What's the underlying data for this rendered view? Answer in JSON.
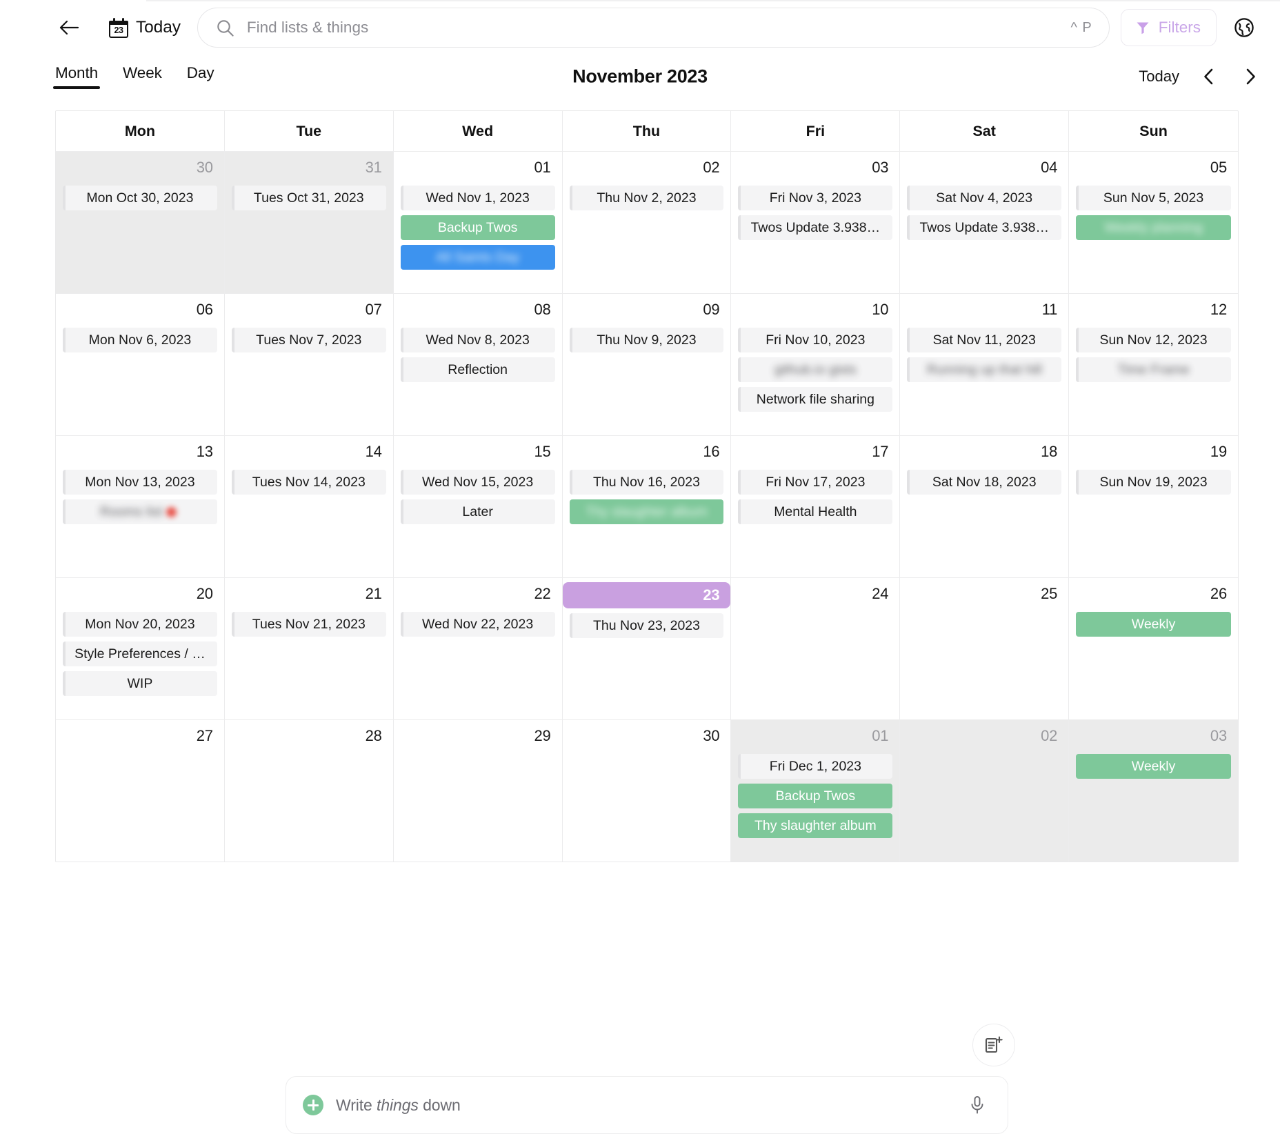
{
  "topbar": {
    "back_icon": "arrow-left-icon",
    "today_jump_label": "Today",
    "calendar_icon_day": "23",
    "search": {
      "placeholder": "Find lists & things",
      "value": "",
      "shortcut": "^ P",
      "icon": "search-icon"
    },
    "filters_label": "Filters",
    "filters_icon": "funnel-icon",
    "globe_icon": "globe-icon"
  },
  "viewbar": {
    "tabs": [
      {
        "label": "Month",
        "active": true
      },
      {
        "label": "Week",
        "active": false
      },
      {
        "label": "Day",
        "active": false
      }
    ],
    "month_title": "November 2023",
    "today_label": "Today",
    "prev_icon": "chevron-left-icon",
    "next_icon": "chevron-right-icon"
  },
  "calendar": {
    "day_headers": [
      "Mon",
      "Tue",
      "Wed",
      "Thu",
      "Fri",
      "Sat",
      "Sun"
    ],
    "weeks": [
      [
        {
          "num": "30",
          "other_month": true,
          "today": false,
          "chips": [
            {
              "text": "Mon Oct 30, 2023",
              "style": "grey"
            }
          ]
        },
        {
          "num": "31",
          "other_month": true,
          "today": false,
          "chips": [
            {
              "text": "Tues Oct 31, 2023",
              "style": "grey"
            }
          ]
        },
        {
          "num": "01",
          "other_month": false,
          "today": false,
          "chips": [
            {
              "text": "Wed Nov 1, 2023",
              "style": "grey"
            },
            {
              "text": "Backup Twos",
              "style": "green"
            },
            {
              "text": "All Saints Day",
              "style": "blue",
              "blurred": true
            }
          ]
        },
        {
          "num": "02",
          "other_month": false,
          "today": false,
          "chips": [
            {
              "text": "Thu Nov 2, 2023",
              "style": "grey"
            }
          ]
        },
        {
          "num": "03",
          "other_month": false,
          "today": false,
          "chips": [
            {
              "text": "Fri Nov 3, 2023",
              "style": "grey"
            },
            {
              "text": "Twos Update 3.938…",
              "style": "grey"
            }
          ]
        },
        {
          "num": "04",
          "other_month": false,
          "today": false,
          "chips": [
            {
              "text": "Sat Nov 4, 2023",
              "style": "grey"
            },
            {
              "text": "Twos Update 3.938…",
              "style": "grey"
            }
          ]
        },
        {
          "num": "05",
          "other_month": false,
          "today": false,
          "chips": [
            {
              "text": "Sun Nov 5, 2023",
              "style": "grey"
            },
            {
              "text": "Weekly planning",
              "style": "green",
              "blurred": true
            }
          ]
        }
      ],
      [
        {
          "num": "06",
          "other_month": false,
          "today": false,
          "chips": [
            {
              "text": "Mon Nov 6, 2023",
              "style": "grey"
            }
          ]
        },
        {
          "num": "07",
          "other_month": false,
          "today": false,
          "chips": [
            {
              "text": "Tues Nov 7, 2023",
              "style": "grey"
            }
          ]
        },
        {
          "num": "08",
          "other_month": false,
          "today": false,
          "chips": [
            {
              "text": "Wed Nov 8, 2023",
              "style": "grey"
            },
            {
              "text": "Reflection",
              "style": "grey"
            }
          ]
        },
        {
          "num": "09",
          "other_month": false,
          "today": false,
          "chips": [
            {
              "text": "Thu Nov 9, 2023",
              "style": "grey"
            }
          ]
        },
        {
          "num": "10",
          "other_month": false,
          "today": false,
          "chips": [
            {
              "text": "Fri Nov 10, 2023",
              "style": "grey"
            },
            {
              "text": "github.io gists",
              "style": "grey",
              "blurred": true
            },
            {
              "text": "Network file sharing",
              "style": "grey"
            }
          ]
        },
        {
          "num": "11",
          "other_month": false,
          "today": false,
          "chips": [
            {
              "text": "Sat Nov 11, 2023",
              "style": "grey"
            },
            {
              "text": "Running up that hill",
              "style": "grey",
              "blurred": true
            }
          ]
        },
        {
          "num": "12",
          "other_month": false,
          "today": false,
          "chips": [
            {
              "text": "Sun Nov 12, 2023",
              "style": "grey"
            },
            {
              "text": "Time Frame",
              "style": "grey",
              "blurred": true
            }
          ]
        }
      ],
      [
        {
          "num": "13",
          "other_month": false,
          "today": false,
          "chips": [
            {
              "text": "Mon Nov 13, 2023",
              "style": "grey"
            },
            {
              "text": "Rooms list",
              "style": "grey",
              "blurred": true,
              "emoji": true
            }
          ]
        },
        {
          "num": "14",
          "other_month": false,
          "today": false,
          "chips": [
            {
              "text": "Tues Nov 14, 2023",
              "style": "grey"
            }
          ]
        },
        {
          "num": "15",
          "other_month": false,
          "today": false,
          "chips": [
            {
              "text": "Wed Nov 15, 2023",
              "style": "grey"
            },
            {
              "text": "Later",
              "style": "grey"
            }
          ]
        },
        {
          "num": "16",
          "other_month": false,
          "today": false,
          "chips": [
            {
              "text": "Thu Nov 16, 2023",
              "style": "grey"
            },
            {
              "text": "Thy slaughter album",
              "style": "green",
              "blurred": true
            }
          ]
        },
        {
          "num": "17",
          "other_month": false,
          "today": false,
          "chips": [
            {
              "text": "Fri Nov 17, 2023",
              "style": "grey"
            },
            {
              "text": "Mental Health",
              "style": "grey"
            }
          ]
        },
        {
          "num": "18",
          "other_month": false,
          "today": false,
          "chips": [
            {
              "text": "Sat Nov 18, 2023",
              "style": "grey"
            }
          ]
        },
        {
          "num": "19",
          "other_month": false,
          "today": false,
          "chips": [
            {
              "text": "Sun Nov 19, 2023",
              "style": "grey"
            }
          ]
        }
      ],
      [
        {
          "num": "20",
          "other_month": false,
          "today": false,
          "chips": [
            {
              "text": "Mon Nov 20, 2023",
              "style": "grey"
            },
            {
              "text": "Style Preferences / …",
              "style": "grey"
            },
            {
              "text": "WIP",
              "style": "grey"
            }
          ]
        },
        {
          "num": "21",
          "other_month": false,
          "today": false,
          "chips": [
            {
              "text": "Tues Nov 21, 2023",
              "style": "grey"
            }
          ]
        },
        {
          "num": "22",
          "other_month": false,
          "today": false,
          "chips": [
            {
              "text": "Wed Nov 22, 2023",
              "style": "grey"
            }
          ]
        },
        {
          "num": "23",
          "other_month": false,
          "today": true,
          "chips": [
            {
              "text": "Thu Nov 23, 2023",
              "style": "grey"
            }
          ]
        },
        {
          "num": "24",
          "other_month": false,
          "today": false,
          "chips": []
        },
        {
          "num": "25",
          "other_month": false,
          "today": false,
          "chips": []
        },
        {
          "num": "26",
          "other_month": false,
          "today": false,
          "chips": [
            {
              "text": "Weekly",
              "style": "green"
            }
          ]
        }
      ],
      [
        {
          "num": "27",
          "other_month": false,
          "today": false,
          "chips": []
        },
        {
          "num": "28",
          "other_month": false,
          "today": false,
          "chips": []
        },
        {
          "num": "29",
          "other_month": false,
          "today": false,
          "chips": []
        },
        {
          "num": "30",
          "other_month": false,
          "today": false,
          "chips": []
        },
        {
          "num": "01",
          "other_month": true,
          "today": false,
          "chips": [
            {
              "text": "Fri Dec 1, 2023",
              "style": "grey"
            },
            {
              "text": "Backup Twos",
              "style": "green"
            },
            {
              "text": "Thy slaughter album",
              "style": "green"
            }
          ]
        },
        {
          "num": "02",
          "other_month": true,
          "today": false,
          "chips": []
        },
        {
          "num": "03",
          "other_month": true,
          "today": false,
          "chips": [
            {
              "text": "Weekly",
              "style": "green"
            }
          ]
        }
      ]
    ]
  },
  "bottom": {
    "fab_icon": "new-note-icon",
    "composer": {
      "placeholder_prefix": "Write ",
      "placeholder_em": "things",
      "placeholder_suffix": " down",
      "value": "",
      "add_icon": "plus-circle-icon",
      "mic_icon": "microphone-icon"
    }
  },
  "colors": {
    "accent_purple": "#c9a0e8",
    "today_highlight": "#c9a0e0",
    "chip_green": "#7ec89a",
    "chip_blue": "#3d93ef",
    "chip_grey": "#f4f4f5"
  }
}
